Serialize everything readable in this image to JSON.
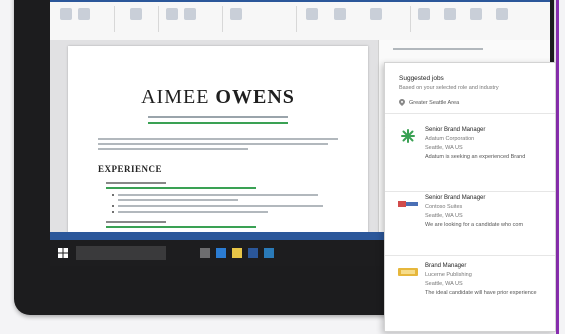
{
  "word": {
    "resume": {
      "first_name": "AIMEE",
      "last_name": "OWENS",
      "section_heading": "EXPERIENCE"
    }
  },
  "suggested_jobs": {
    "title": "Suggested jobs",
    "subtitle": "Based on your selected role and industry",
    "location": "Greater Seattle Area",
    "jobs": [
      {
        "title": "Senior Brand Manager",
        "company": "Adatum Corporation",
        "location": "Seattle, WA US",
        "description": "Adatum is seeking an experienced Brand"
      },
      {
        "title": "Senior Brand Manager",
        "company": "Contoso Suites",
        "location": "Seattle, WA US",
        "description": "We are looking for a candidate who com"
      },
      {
        "title": "Brand Manager",
        "company": "Lucerne Publishing",
        "location": "Seattle, WA US",
        "description": "The ideal candidate will have prior experience"
      }
    ]
  },
  "colors": {
    "word_blue": "#2b579a",
    "accent_purple": "#8b2fb3",
    "resume_green": "#3aa154"
  }
}
